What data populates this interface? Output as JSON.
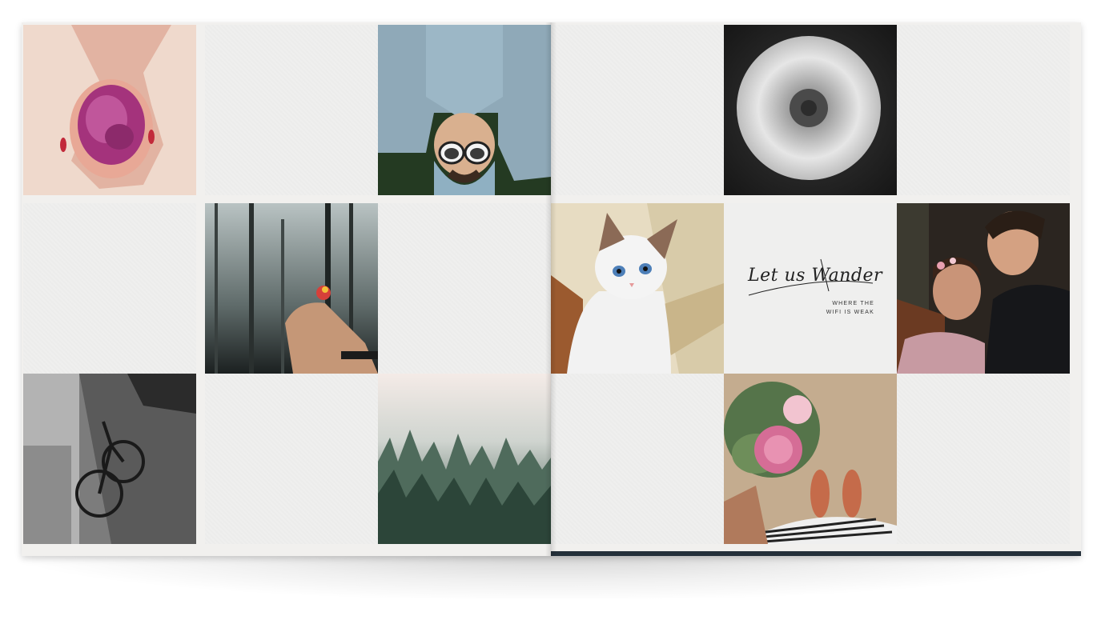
{
  "layout_card": {
    "title": "Let us Wander",
    "subtitle_line1": "WHERE THE",
    "subtitle_line2": "WIFI IS WEAK"
  },
  "photos": [
    {
      "subject": "hands holding pink petals"
    },
    {
      "subject": "person lying on grass with sunglasses"
    },
    {
      "subject": "dandelion seed head"
    },
    {
      "subject": "misty forest with hand holding flower"
    },
    {
      "subject": "white kitten with blue eyes"
    },
    {
      "subject": "couple embracing"
    },
    {
      "subject": "bicycle against wall on wet street"
    },
    {
      "subject": "foggy pine forest"
    },
    {
      "subject": "peony bouquet and sandals"
    }
  ]
}
